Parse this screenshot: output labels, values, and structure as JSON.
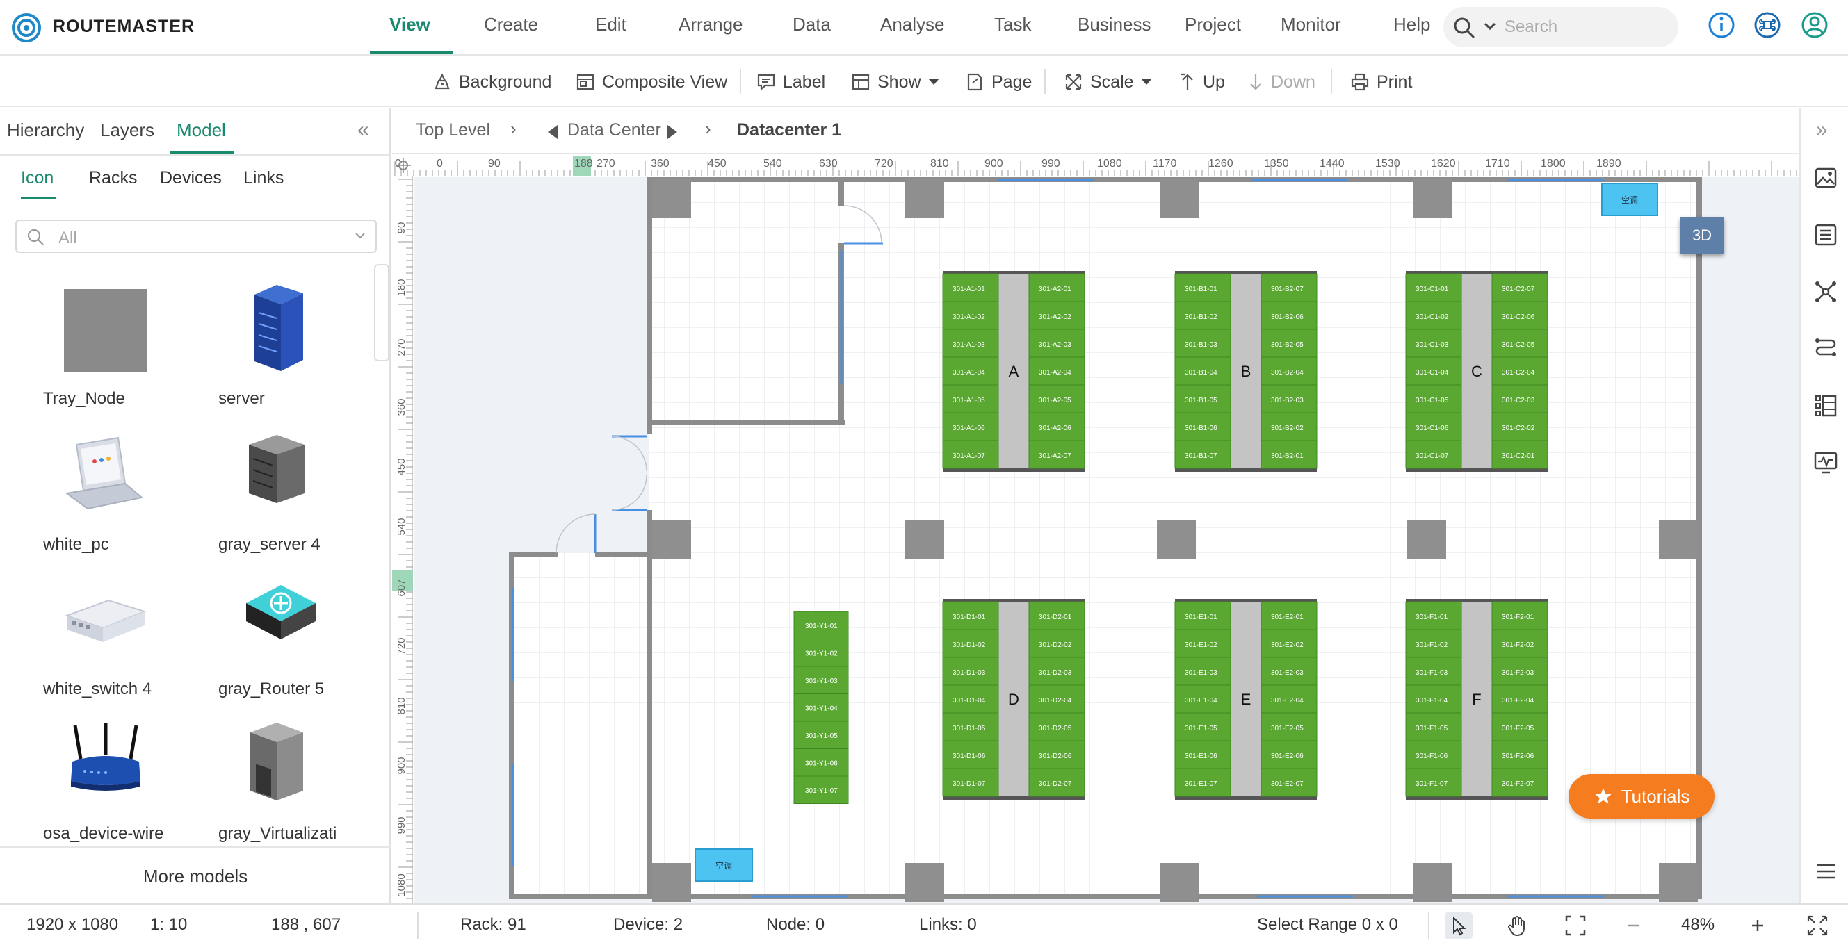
{
  "app": {
    "brand": "ROUTEMASTER"
  },
  "nav": {
    "items": [
      "View",
      "Create",
      "Edit",
      "Arrange",
      "Data",
      "Analyse",
      "Task",
      "Business",
      "Project",
      "Monitor",
      "Help"
    ],
    "active": "View",
    "search_placeholder": "Search"
  },
  "toolbar": {
    "background": "Background",
    "composite_view": "Composite View",
    "label": "Label",
    "show": "Show",
    "page": "Page",
    "scale": "Scale",
    "up": "Up",
    "down": "Down",
    "print": "Print"
  },
  "left_panel": {
    "tabs": [
      "Hierarchy",
      "Layers",
      "Model"
    ],
    "active_tab": "Model",
    "subtabs": [
      "Icon",
      "Racks",
      "Devices",
      "Links"
    ],
    "active_subtab": "Icon",
    "filter_value": "All",
    "models": [
      {
        "name": "Tray_Node",
        "icon": "tray-node-icon"
      },
      {
        "name": "server",
        "icon": "server-icon"
      },
      {
        "name": "white_pc",
        "icon": "laptop-icon"
      },
      {
        "name": "gray_server 4",
        "icon": "gray-server-icon"
      },
      {
        "name": "white_switch 4",
        "icon": "switch-icon"
      },
      {
        "name": "gray_Router 5",
        "icon": "router-icon"
      },
      {
        "name": "osa_device-wire",
        "icon": "wireless-router-icon"
      },
      {
        "name": "gray_Virtualizati",
        "icon": "virtualization-server-icon"
      }
    ],
    "more_models": "More models"
  },
  "breadcrumb": {
    "top_level": "Top Level",
    "data_center": "Data Center",
    "current": "Datacenter 1"
  },
  "ruler": {
    "top_labels": [
      "0",
      "0",
      "90",
      "188",
      "270",
      "360",
      "450",
      "540",
      "630",
      "720",
      "810",
      "900",
      "990",
      "1080",
      "1170",
      "1260",
      "1350",
      "1440",
      "1530",
      "1620",
      "1710",
      "1800",
      "1890"
    ],
    "left_labels": [
      "90",
      "180",
      "270",
      "360",
      "450",
      "540",
      "607",
      "720",
      "810",
      "900",
      "990",
      "1080"
    ],
    "marker_x": "188",
    "marker_y": "607"
  },
  "floor": {
    "rows": [
      {
        "label": "A",
        "left_prefix": "301-A1",
        "right_prefix": "301-A2",
        "right_desc": false
      },
      {
        "label": "B",
        "left_prefix": "301-B1",
        "right_prefix": "301-B2",
        "right_desc": true
      },
      {
        "label": "C",
        "left_prefix": "301-C1",
        "right_prefix": "301-C2",
        "right_desc": true
      },
      {
        "label": "D",
        "left_prefix": "301-D1",
        "right_prefix": "301-D2",
        "right_desc": false
      },
      {
        "label": "E",
        "left_prefix": "301-E1",
        "right_prefix": "301-E2",
        "right_desc": false
      },
      {
        "label": "F",
        "left_prefix": "301-F1",
        "right_prefix": "301-F2",
        "right_desc": false
      }
    ],
    "single_row_prefix": "301-Y1",
    "ac_label": "空调",
    "racks_per_column": 7
  },
  "floating": {
    "view_3d": "3D",
    "tutorials": "Tutorials"
  },
  "status": {
    "resolution": "1920 x 1080",
    "scale": "1: 10",
    "coords": "188 , 607",
    "rack": "Rack: 91",
    "device": "Device: 2",
    "node": "Node: 0",
    "links": "Links: 0",
    "select_range": "Select Range  0 x 0",
    "zoom": "48%"
  },
  "colors": {
    "accent": "#1a8a6e",
    "rack_green": "#5aa832",
    "tutorials_orange": "#f57c1f",
    "ac_blue": "#4cc3f0",
    "wall_gray": "#8c8c8c"
  }
}
